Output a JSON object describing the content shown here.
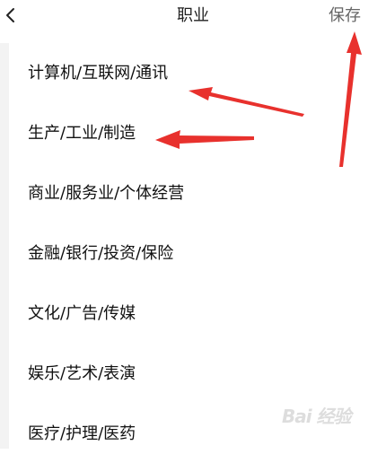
{
  "header": {
    "title": "职业",
    "save_label": "保存",
    "back_icon": "chevron-left-icon"
  },
  "occupations": [
    "计算机/互联网/通讯",
    "生产/工业/制造",
    "商业/服务业/个体经营",
    "金融/银行/投资/保险",
    "文化/广告/传媒",
    "娱乐/艺术/表演",
    "医疗/护理/医药"
  ],
  "annotation": {
    "arrow_color": "#e8312d"
  },
  "watermark": "Bai 经验"
}
